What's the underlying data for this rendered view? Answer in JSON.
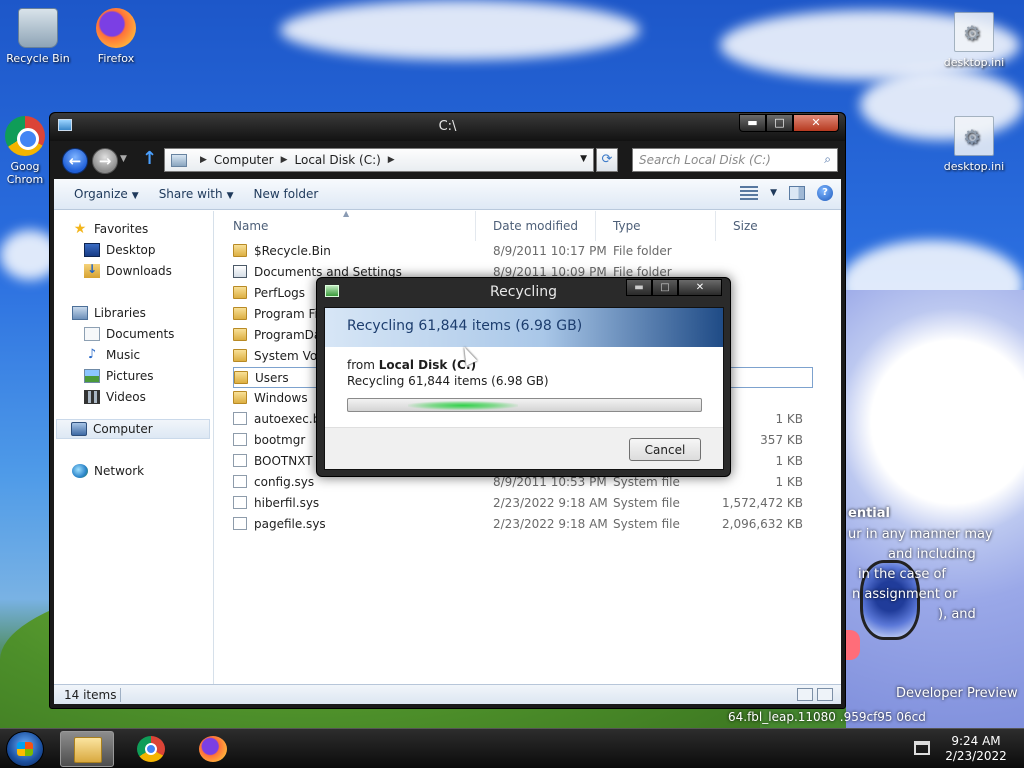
{
  "desktop": {
    "icons": {
      "recycle_bin": "Recycle Bin",
      "firefox": "Firefox",
      "chrome": "Goog Chrom",
      "desktop_ini_1": "desktop.ini",
      "desktop_ini_2": "desktop.ini"
    },
    "overlay_text": {
      "l1": "ential",
      "l2": "ur in any manner may",
      "l3": "and including",
      "l4": "in the case of",
      "l5": "n assignment or",
      "l6": "), and",
      "l7": "Developer Preview",
      "l8": "64.fbl_leap.11080 .959cf95 06cd"
    }
  },
  "explorer": {
    "title": "C:\\",
    "window_buttons": {
      "minimize": "▬",
      "maximize": "□",
      "close": "✕"
    },
    "address": {
      "crumbs": [
        "Computer",
        "Local Disk (C:)"
      ]
    },
    "search_placeholder": "Search Local Disk (C:)",
    "commands": {
      "organize": "Organize",
      "share_with": "Share with",
      "new_folder": "New folder"
    },
    "nav_pane": {
      "favorites": "Favorites",
      "desktop": "Desktop",
      "downloads": "Downloads",
      "libraries": "Libraries",
      "documents": "Documents",
      "music": "Music",
      "pictures": "Pictures",
      "videos": "Videos",
      "computer": "Computer",
      "network": "Network"
    },
    "columns": {
      "name": "Name",
      "date_modified": "Date modified",
      "type": "Type",
      "size": "Size"
    },
    "files": [
      {
        "name": "$Recycle.Bin",
        "date": "8/9/2011 10:17 PM",
        "type": "File folder",
        "size": ""
      },
      {
        "name": "Documents and Settings",
        "date": "8/9/2011 10:09 PM",
        "type": "File folder",
        "size": ""
      },
      {
        "name": "PerfLogs",
        "date": "",
        "type": "",
        "size": ""
      },
      {
        "name": "Program File",
        "date": "",
        "type": "",
        "size": ""
      },
      {
        "name": "ProgramDat",
        "date": "",
        "type": "",
        "size": ""
      },
      {
        "name": "System Volu",
        "date": "",
        "type": "",
        "size": ""
      },
      {
        "name": "Users",
        "date": "",
        "type": "",
        "size": ""
      },
      {
        "name": "Windows",
        "date": "",
        "type": "",
        "size": ""
      },
      {
        "name": "autoexec.ba",
        "date": "",
        "type": "",
        "size": "1 KB"
      },
      {
        "name": "bootmgr",
        "date": "",
        "type": "",
        "size": "357 KB"
      },
      {
        "name": "BOOTNXT",
        "date": "",
        "type": "",
        "size": "1 KB"
      },
      {
        "name": "config.sys",
        "date": "8/9/2011 10:53 PM",
        "type": "System file",
        "size": "1 KB"
      },
      {
        "name": "hiberfil.sys",
        "date": "2/23/2022 9:18 AM",
        "type": "System file",
        "size": "1,572,472 KB"
      },
      {
        "name": "pagefile.sys",
        "date": "2/23/2022 9:18 AM",
        "type": "System file",
        "size": "2,096,632 KB"
      }
    ],
    "status": {
      "item_count": "14 items"
    }
  },
  "dialog": {
    "title": "Recycling",
    "heading": "Recycling 61,844 items (6.98 GB)",
    "from_label": "from",
    "from_location": "Local Disk (C:)",
    "subtext": "Recycling 61,844 items (6.98 GB)",
    "cancel": "Cancel",
    "window_buttons": {
      "minimize": "▬",
      "maximize": "□",
      "close": "✕"
    }
  },
  "taskbar": {
    "time": "9:24 AM",
    "date": "2/23/2022"
  }
}
